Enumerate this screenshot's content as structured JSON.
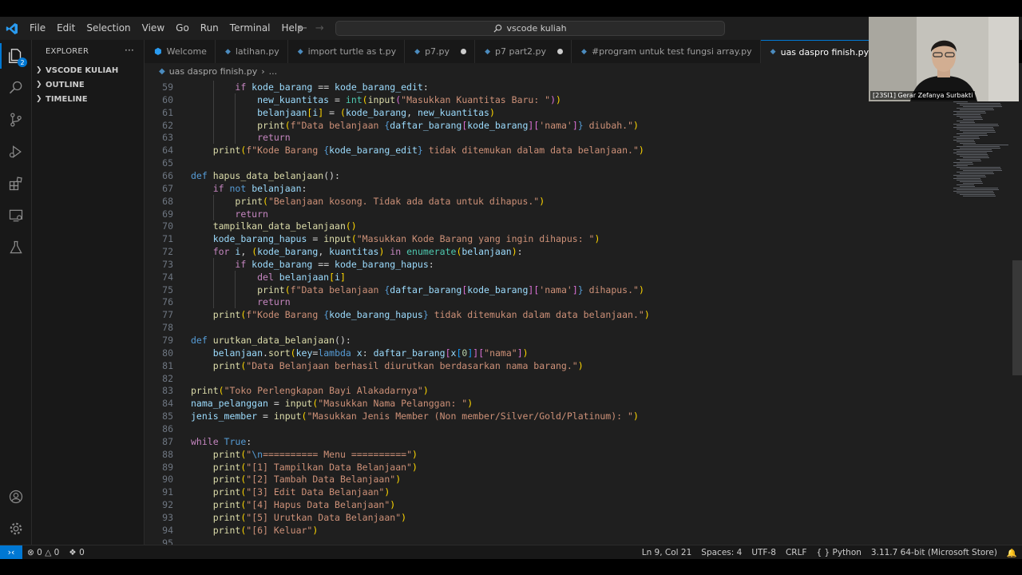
{
  "menu": [
    "File",
    "Edit",
    "Selection",
    "View",
    "Go",
    "Run",
    "Terminal",
    "Help"
  ],
  "search": {
    "text": "vscode kuliah"
  },
  "activity": {
    "explorer_badge": "2"
  },
  "sidebar": {
    "title": "EXPLORER",
    "more": "···",
    "sections": [
      "VSCODE KULIAH",
      "OUTLINE",
      "TIMELINE"
    ]
  },
  "tabs": [
    {
      "label": "Welcome",
      "state": "normal"
    },
    {
      "label": "latihan.py",
      "state": "normal"
    },
    {
      "label": "import turtle as t.py",
      "state": "normal"
    },
    {
      "label": "p7.py",
      "state": "dirty"
    },
    {
      "label": "p7 part2.py",
      "state": "dirty"
    },
    {
      "label": "#program untuk test fungsi array.py",
      "state": "normal"
    },
    {
      "label": "uas daspro finish.py",
      "state": "active"
    }
  ],
  "breadcrumb": {
    "file": "uas daspro finish.py",
    "sep": "›",
    "rest": "..."
  },
  "webcam": {
    "label": "[23SI1] Gerar Zefanya Surbakti"
  },
  "line_numbers": [
    "59",
    "60",
    "61",
    "62",
    "63",
    "64",
    "65",
    "66",
    "67",
    "68",
    "69",
    "70",
    "71",
    "72",
    "73",
    "74",
    "75",
    "76",
    "77",
    "78",
    "79",
    "80",
    "81",
    "82",
    "83",
    "84",
    "85",
    "86",
    "87",
    "88",
    "89",
    "90",
    "91",
    "92",
    "93",
    "94",
    "95"
  ],
  "code_tokens": [
    [
      [
        "        ",
        "o"
      ],
      [
        "if ",
        "k"
      ],
      [
        "kode_barang ",
        "v"
      ],
      [
        "== ",
        "o"
      ],
      [
        "kode_barang_edit",
        "v"
      ],
      [
        ":",
        "o"
      ]
    ],
    [
      [
        "            ",
        "o"
      ],
      [
        "new_kuantitas ",
        "v"
      ],
      [
        "= ",
        "o"
      ],
      [
        "int",
        "t"
      ],
      [
        "(",
        "b1"
      ],
      [
        "input",
        "f"
      ],
      [
        "(",
        "b2"
      ],
      [
        "\"Masukkan Kuantitas Baru: \"",
        "s"
      ],
      [
        ")",
        "b2"
      ],
      [
        ")",
        "b1"
      ]
    ],
    [
      [
        "            ",
        "o"
      ],
      [
        "belanjaan",
        "v"
      ],
      [
        "[",
        "b1"
      ],
      [
        "i",
        "v"
      ],
      [
        "] ",
        "b1"
      ],
      [
        "= ",
        "o"
      ],
      [
        "(",
        "b1"
      ],
      [
        "kode_barang",
        "v"
      ],
      [
        ", ",
        "o"
      ],
      [
        "new_kuantitas",
        "v"
      ],
      [
        ")",
        "b1"
      ]
    ],
    [
      [
        "            ",
        "o"
      ],
      [
        "print",
        "f"
      ],
      [
        "(",
        "b1"
      ],
      [
        "f\"Data belanjaan ",
        "s"
      ],
      [
        "{",
        "d"
      ],
      [
        "daftar_barang",
        "v"
      ],
      [
        "[",
        "b2"
      ],
      [
        "kode_barang",
        "v"
      ],
      [
        "][",
        "b2"
      ],
      [
        "'nama'",
        "s"
      ],
      [
        "]",
        "b2"
      ],
      [
        "}",
        "d"
      ],
      [
        " diubah.\"",
        "s"
      ],
      [
        ")",
        "b1"
      ]
    ],
    [
      [
        "            ",
        "o"
      ],
      [
        "return",
        "k"
      ]
    ],
    [
      [
        "    ",
        "o"
      ],
      [
        "print",
        "f"
      ],
      [
        "(",
        "b1"
      ],
      [
        "f\"Kode Barang ",
        "s"
      ],
      [
        "{",
        "d"
      ],
      [
        "kode_barang_edit",
        "v"
      ],
      [
        "}",
        "d"
      ],
      [
        " tidak ditemukan dalam data belanjaan.\"",
        "s"
      ],
      [
        ")",
        "b1"
      ]
    ],
    [
      [
        "",
        "o"
      ]
    ],
    [
      [
        "def ",
        "d"
      ],
      [
        "hapus_data_belanjaan",
        "f"
      ],
      [
        "():",
        "o"
      ]
    ],
    [
      [
        "    ",
        "o"
      ],
      [
        "if ",
        "k"
      ],
      [
        "not ",
        "d"
      ],
      [
        "belanjaan",
        "v"
      ],
      [
        ":",
        "o"
      ]
    ],
    [
      [
        "        ",
        "o"
      ],
      [
        "print",
        "f"
      ],
      [
        "(",
        "b1"
      ],
      [
        "\"Belanjaan kosong. Tidak ada data untuk dihapus.\"",
        "s"
      ],
      [
        ")",
        "b1"
      ]
    ],
    [
      [
        "        ",
        "o"
      ],
      [
        "return",
        "k"
      ]
    ],
    [
      [
        "    ",
        "o"
      ],
      [
        "tampilkan_data_belanjaan",
        "f"
      ],
      [
        "()",
        "b1"
      ]
    ],
    [
      [
        "    ",
        "o"
      ],
      [
        "kode_barang_hapus ",
        "v"
      ],
      [
        "= ",
        "o"
      ],
      [
        "input",
        "f"
      ],
      [
        "(",
        "b1"
      ],
      [
        "\"Masukkan Kode Barang yang ingin dihapus: \"",
        "s"
      ],
      [
        ")",
        "b1"
      ]
    ],
    [
      [
        "    ",
        "o"
      ],
      [
        "for ",
        "k"
      ],
      [
        "i",
        "v"
      ],
      [
        ", ",
        "o"
      ],
      [
        "(",
        "b1"
      ],
      [
        "kode_barang",
        "v"
      ],
      [
        ", ",
        "o"
      ],
      [
        "kuantitas",
        "v"
      ],
      [
        ") ",
        "b1"
      ],
      [
        "in ",
        "k"
      ],
      [
        "enumerate",
        "t"
      ],
      [
        "(",
        "b1"
      ],
      [
        "belanjaan",
        "v"
      ],
      [
        ")",
        "b1"
      ],
      [
        ":",
        "o"
      ]
    ],
    [
      [
        "        ",
        "o"
      ],
      [
        "if ",
        "k"
      ],
      [
        "kode_barang ",
        "v"
      ],
      [
        "== ",
        "o"
      ],
      [
        "kode_barang_hapus",
        "v"
      ],
      [
        ":",
        "o"
      ]
    ],
    [
      [
        "            ",
        "o"
      ],
      [
        "del ",
        "k"
      ],
      [
        "belanjaan",
        "v"
      ],
      [
        "[",
        "b1"
      ],
      [
        "i",
        "v"
      ],
      [
        "]",
        "b1"
      ]
    ],
    [
      [
        "            ",
        "o"
      ],
      [
        "print",
        "f"
      ],
      [
        "(",
        "b1"
      ],
      [
        "f\"Data belanjaan ",
        "s"
      ],
      [
        "{",
        "d"
      ],
      [
        "daftar_barang",
        "v"
      ],
      [
        "[",
        "b2"
      ],
      [
        "kode_barang",
        "v"
      ],
      [
        "][",
        "b2"
      ],
      [
        "'nama'",
        "s"
      ],
      [
        "]",
        "b2"
      ],
      [
        "}",
        "d"
      ],
      [
        " dihapus.\"",
        "s"
      ],
      [
        ")",
        "b1"
      ]
    ],
    [
      [
        "            ",
        "o"
      ],
      [
        "return",
        "k"
      ]
    ],
    [
      [
        "    ",
        "o"
      ],
      [
        "print",
        "f"
      ],
      [
        "(",
        "b1"
      ],
      [
        "f\"Kode Barang ",
        "s"
      ],
      [
        "{",
        "d"
      ],
      [
        "kode_barang_hapus",
        "v"
      ],
      [
        "}",
        "d"
      ],
      [
        " tidak ditemukan dalam data belanjaan.\"",
        "s"
      ],
      [
        ")",
        "b1"
      ]
    ],
    [
      [
        "",
        "o"
      ]
    ],
    [
      [
        "def ",
        "d"
      ],
      [
        "urutkan_data_belanjaan",
        "f"
      ],
      [
        "():",
        "o"
      ]
    ],
    [
      [
        "    ",
        "o"
      ],
      [
        "belanjaan",
        "v"
      ],
      [
        ".",
        "o"
      ],
      [
        "sort",
        "f"
      ],
      [
        "(",
        "b1"
      ],
      [
        "key",
        "v"
      ],
      [
        "=",
        "o"
      ],
      [
        "lambda ",
        "d"
      ],
      [
        "x",
        "v"
      ],
      [
        ": ",
        "o"
      ],
      [
        "daftar_barang",
        "v"
      ],
      [
        "[",
        "b2"
      ],
      [
        "x",
        "v"
      ],
      [
        "[",
        "b3"
      ],
      [
        "0",
        "n"
      ],
      [
        "]",
        "b3"
      ],
      [
        "]",
        "b2"
      ],
      [
        "[",
        "b2"
      ],
      [
        "\"nama\"",
        "s"
      ],
      [
        "]",
        "b2"
      ],
      [
        ")",
        "b1"
      ]
    ],
    [
      [
        "    ",
        "o"
      ],
      [
        "print",
        "f"
      ],
      [
        "(",
        "b1"
      ],
      [
        "\"Data Belanjaan berhasil diurutkan berdasarkan nama barang.\"",
        "s"
      ],
      [
        ")",
        "b1"
      ]
    ],
    [
      [
        "",
        "o"
      ]
    ],
    [
      [
        "print",
        "f"
      ],
      [
        "(",
        "b1"
      ],
      [
        "\"Toko Perlengkapan Bayi Alakadarnya\"",
        "s"
      ],
      [
        ")",
        "b1"
      ]
    ],
    [
      [
        "nama_pelanggan ",
        "v"
      ],
      [
        "= ",
        "o"
      ],
      [
        "input",
        "f"
      ],
      [
        "(",
        "b1"
      ],
      [
        "\"Masukkan Nama Pelanggan: \"",
        "s"
      ],
      [
        ")",
        "b1"
      ]
    ],
    [
      [
        "jenis_member ",
        "v"
      ],
      [
        "= ",
        "o"
      ],
      [
        "input",
        "f"
      ],
      [
        "(",
        "b1"
      ],
      [
        "\"Masukkan Jenis Member (Non member/Silver/Gold/Platinum): \"",
        "s"
      ],
      [
        ")",
        "b1"
      ]
    ],
    [
      [
        "",
        "o"
      ]
    ],
    [
      [
        "while ",
        "k"
      ],
      [
        "True",
        "d"
      ],
      [
        ":",
        "o"
      ]
    ],
    [
      [
        "    ",
        "o"
      ],
      [
        "print",
        "f"
      ],
      [
        "(",
        "b1"
      ],
      [
        "\"",
        "s"
      ],
      [
        "\\n",
        "d"
      ],
      [
        "========== Menu ==========\"",
        "s"
      ],
      [
        ")",
        "b1"
      ]
    ],
    [
      [
        "    ",
        "o"
      ],
      [
        "print",
        "f"
      ],
      [
        "(",
        "b1"
      ],
      [
        "\"[1] Tampilkan Data Belanjaan\"",
        "s"
      ],
      [
        ")",
        "b1"
      ]
    ],
    [
      [
        "    ",
        "o"
      ],
      [
        "print",
        "f"
      ],
      [
        "(",
        "b1"
      ],
      [
        "\"[2] Tambah Data Belanjaan\"",
        "s"
      ],
      [
        ")",
        "b1"
      ]
    ],
    [
      [
        "    ",
        "o"
      ],
      [
        "print",
        "f"
      ],
      [
        "(",
        "b1"
      ],
      [
        "\"[3] Edit Data Belanjaan\"",
        "s"
      ],
      [
        ")",
        "b1"
      ]
    ],
    [
      [
        "    ",
        "o"
      ],
      [
        "print",
        "f"
      ],
      [
        "(",
        "b1"
      ],
      [
        "\"[4] Hapus Data Belanjaan\"",
        "s"
      ],
      [
        ")",
        "b1"
      ]
    ],
    [
      [
        "    ",
        "o"
      ],
      [
        "print",
        "f"
      ],
      [
        "(",
        "b1"
      ],
      [
        "\"[5] Urutkan Data Belanjaan\"",
        "s"
      ],
      [
        ")",
        "b1"
      ]
    ],
    [
      [
        "    ",
        "o"
      ],
      [
        "print",
        "f"
      ],
      [
        "(",
        "b1"
      ],
      [
        "\"[6] Keluar\"",
        "s"
      ],
      [
        ")",
        "b1"
      ]
    ],
    [
      [
        "",
        "o"
      ]
    ]
  ],
  "status": {
    "errors": "0",
    "warnings": "0",
    "ports": "0",
    "position": "Ln 9, Col 21",
    "spaces": "Spaces: 4",
    "encoding": "UTF-8",
    "eol": "CRLF",
    "language": "Python",
    "interpreter": "3.11.7 64-bit (Microsoft Store)"
  },
  "colors": {
    "accent": "#0078d4",
    "editor_bg": "#1f1f1f",
    "sidebar_bg": "#181818"
  }
}
